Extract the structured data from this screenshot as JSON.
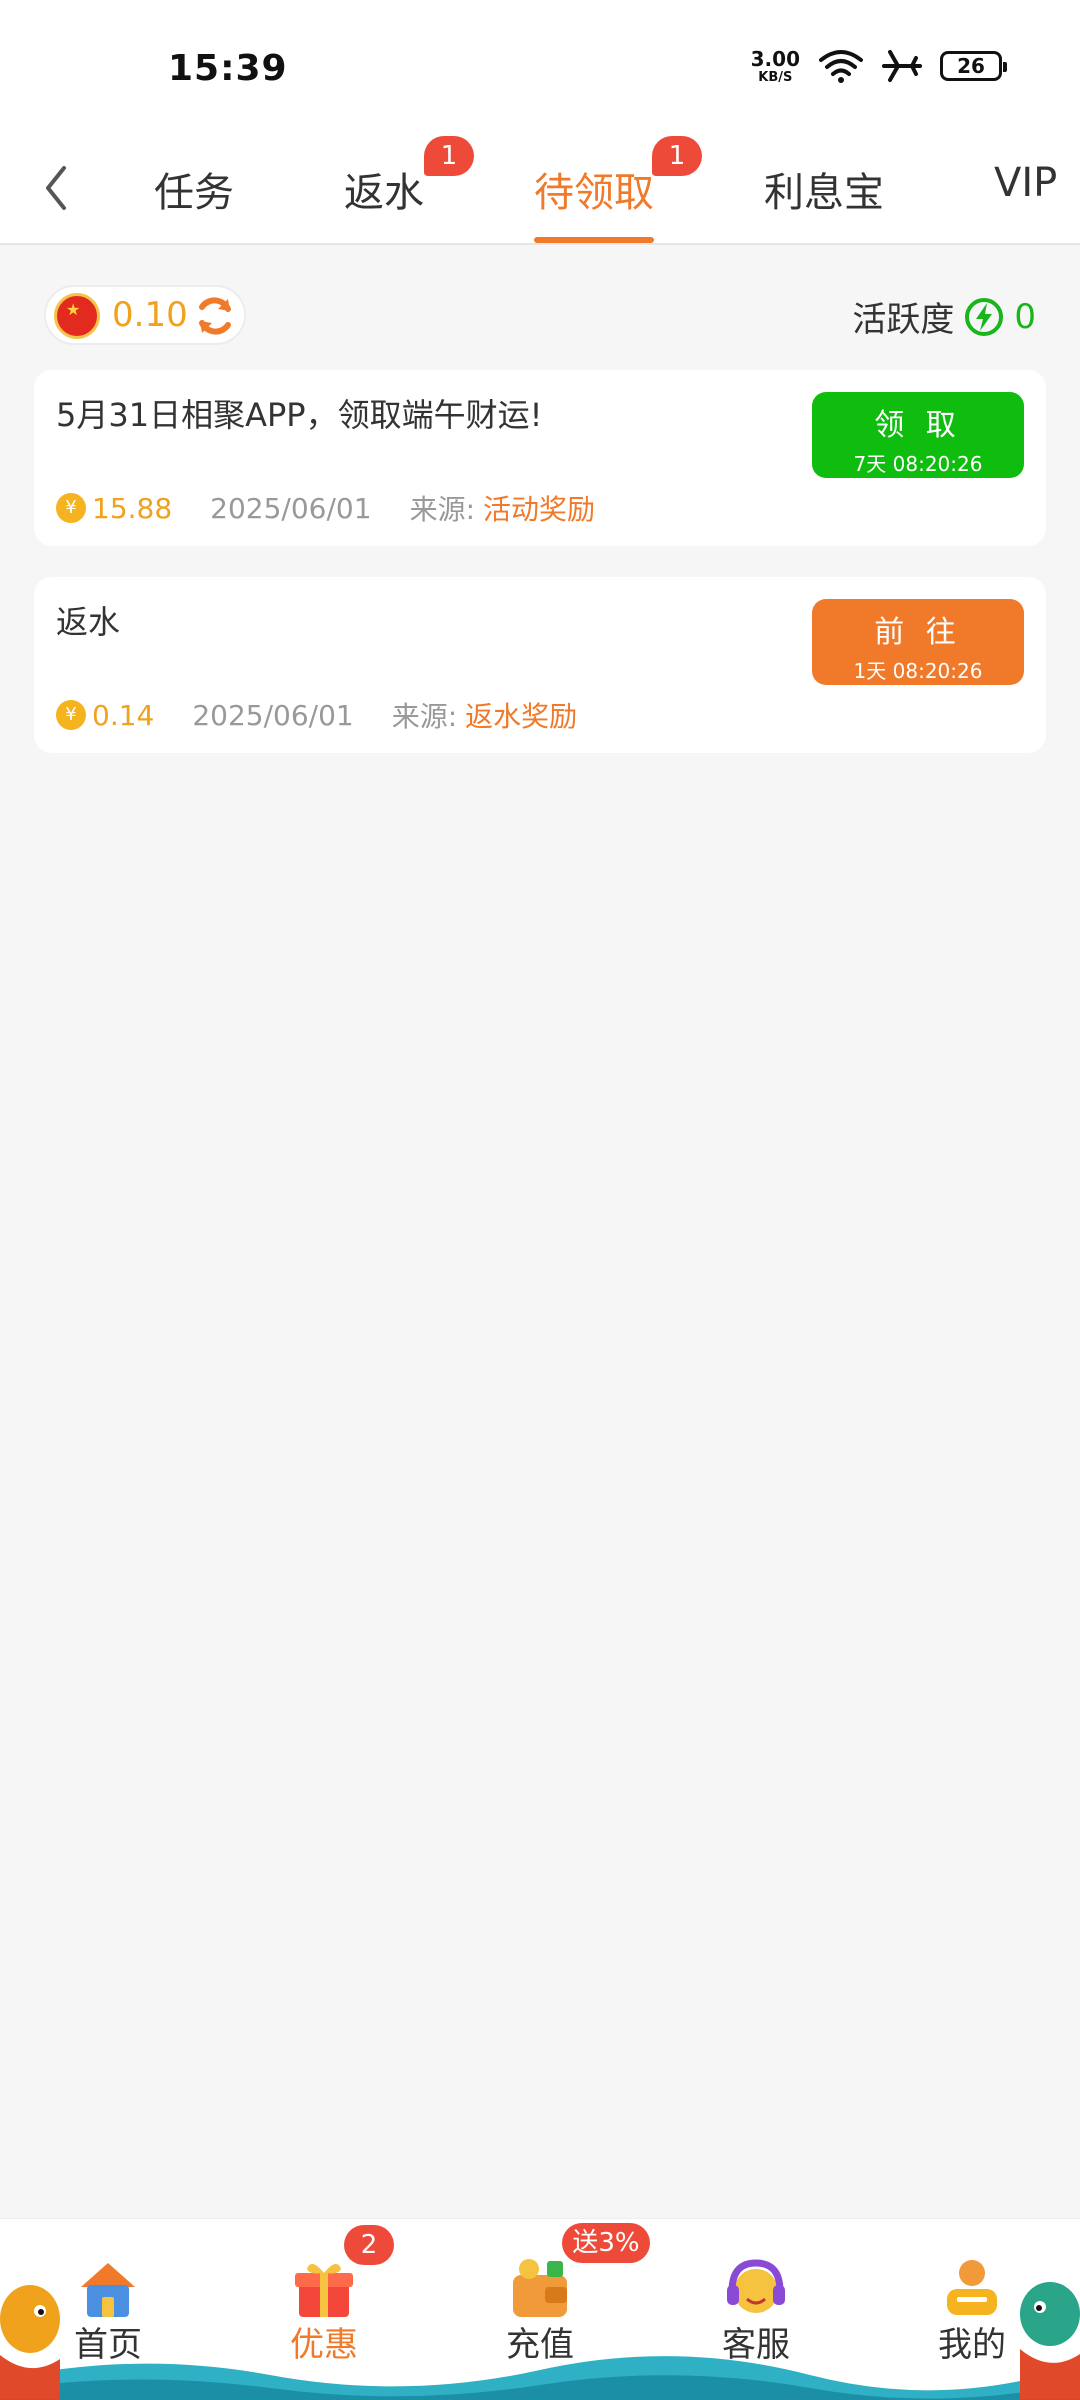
{
  "status_bar": {
    "time": "15:39",
    "net_speed_value": "3.00",
    "net_speed_unit": "KB/S",
    "battery": "26"
  },
  "tabs": {
    "items": [
      {
        "label": "任务"
      },
      {
        "label": "返水",
        "badge": "1"
      },
      {
        "label": "待领取",
        "badge": "1"
      },
      {
        "label": "利息宝"
      },
      {
        "label": "VIP"
      }
    ],
    "active_index": 2
  },
  "balance": {
    "value": "0.10",
    "activity_label": "活跃度",
    "activity_value": "0"
  },
  "cards": [
    {
      "title": "5月31日相聚APP，领取端午财运!",
      "button_label": "领 取",
      "button_time": "7天 08:20:26",
      "amount": "15.88",
      "date": "2025/06/01",
      "source_label": "来源:",
      "source_value": "活动奖励"
    },
    {
      "title": "返水",
      "button_label": "前 往",
      "button_time": "1天 08:20:26",
      "amount": "0.14",
      "date": "2025/06/01",
      "source_label": "来源:",
      "source_value": "返水奖励"
    }
  ],
  "bottom_nav": {
    "items": [
      {
        "label": "首页"
      },
      {
        "label": "优惠",
        "badge": "2"
      },
      {
        "label": "充值",
        "badge": "送3%"
      },
      {
        "label": "客服"
      },
      {
        "label": "我的"
      }
    ],
    "active_index": 1
  },
  "colors": {
    "accent": "#f07a2a",
    "green": "#0fbd0f",
    "gold": "#f0a21c",
    "badge": "#ee4a3a"
  }
}
